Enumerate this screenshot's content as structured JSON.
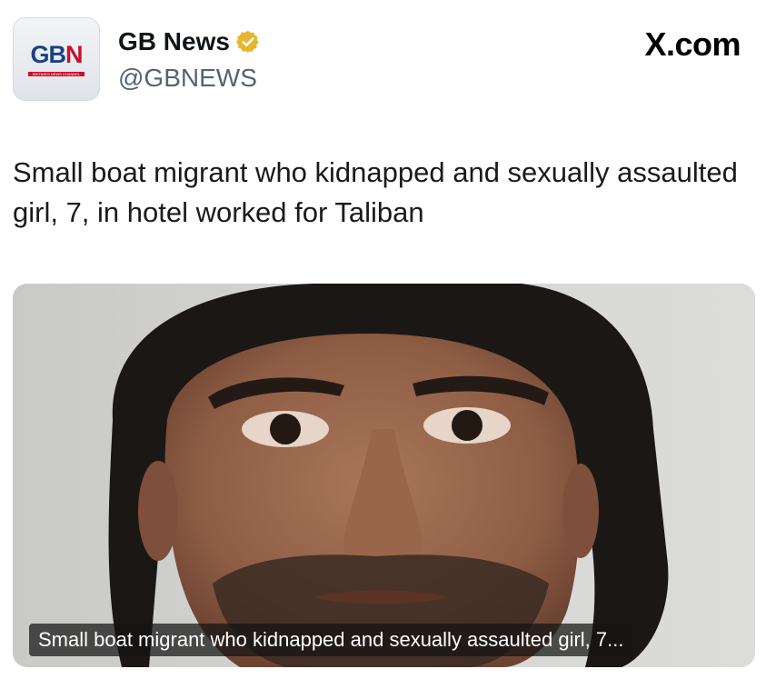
{
  "header": {
    "logo_text_1": "GB",
    "logo_text_2": "N",
    "logo_subtext": "BRITAIN'S NEWS CHANNEL",
    "account_name": "GB News",
    "verified_icon": "verified-badge-icon",
    "handle": "@GBNEWS",
    "site": "X.com"
  },
  "tweet": {
    "text": "Small boat migrant who kidnapped and sexually assaulted girl, 7, in hotel worked for Taliban"
  },
  "media": {
    "caption": "Small boat migrant who kidnapped and sexually assaulted girl, 7..."
  },
  "colors": {
    "brand_blue": "#1d3f86",
    "brand_red": "#c8102e",
    "verified_gold": "#e8b62c",
    "handle_gray": "#536471"
  }
}
